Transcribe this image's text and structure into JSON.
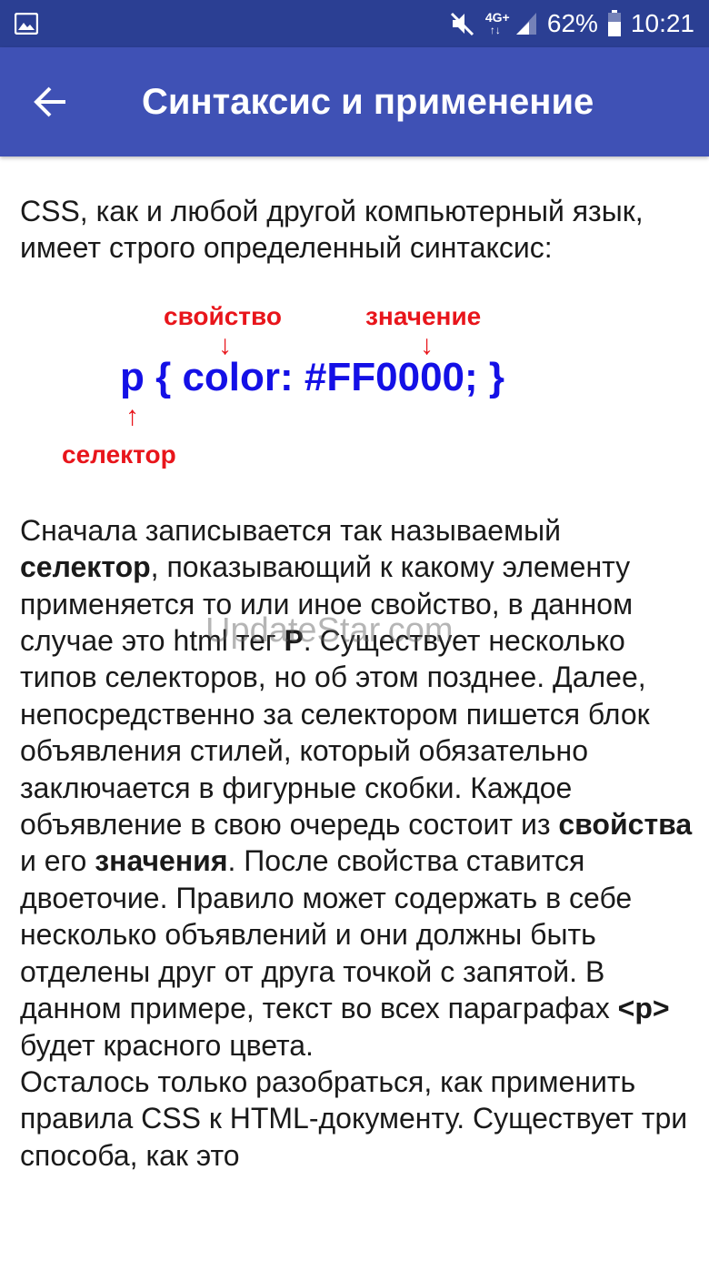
{
  "status_bar": {
    "gallery_icon": "image-icon",
    "mute_icon": "volume-off-icon",
    "network_label_top": "4G+",
    "network_label_bottom": "↑↓",
    "signal_icon": "signal-bars-icon",
    "battery_percent": "62%",
    "battery_icon": "battery-icon",
    "time": "10:21"
  },
  "toolbar": {
    "back_icon": "arrow-back-icon",
    "title": "Синтаксис и применение"
  },
  "intro": " CSS, как и любой другой компьютерный язык, имеет строго определенный синтаксис:",
  "diagram": {
    "property_label": "свойство",
    "value_label": "значение",
    "selector_label": "селектор",
    "arrow_down": "↓",
    "arrow_up": "↑",
    "code": "p { color: #FF0000; }"
  },
  "body": {
    "s1": " Сначала записывается так называемый ",
    "b1": "селектор",
    "s2": ", показывающий к какому элементу применяется то или иное свойство, в данном случае это html тег ",
    "b2": "P",
    "s3": ". Существует несколько типов селекторов, но об этом позднее. Далее, непосредственно за селектором пишется блок объявления стилей, который обязательно заключается в фигурные скобки. Каждое объявление в свою очередь состоит из ",
    "b3": "свойства",
    "s4": " и его ",
    "b4": "значения",
    "s5": ". После свойства ставится двоеточие. Правило может содержать в себе несколько объявлений и они должны быть отделены друг от друга точкой с запятой. В данном примере, текст во всех параграфах ",
    "b5": "<p>",
    "s6": " будет красного цвета.",
    "s7": " Осталось только разобраться, как применить правила CSS к HTML-документу. Существует три способа, как это"
  },
  "watermark": "UpdateStar.com",
  "colors": {
    "status_bar": "#2b3f93",
    "toolbar": "#3f51b5",
    "diagram_red": "#e8151b",
    "diagram_blue": "#1410e6"
  }
}
